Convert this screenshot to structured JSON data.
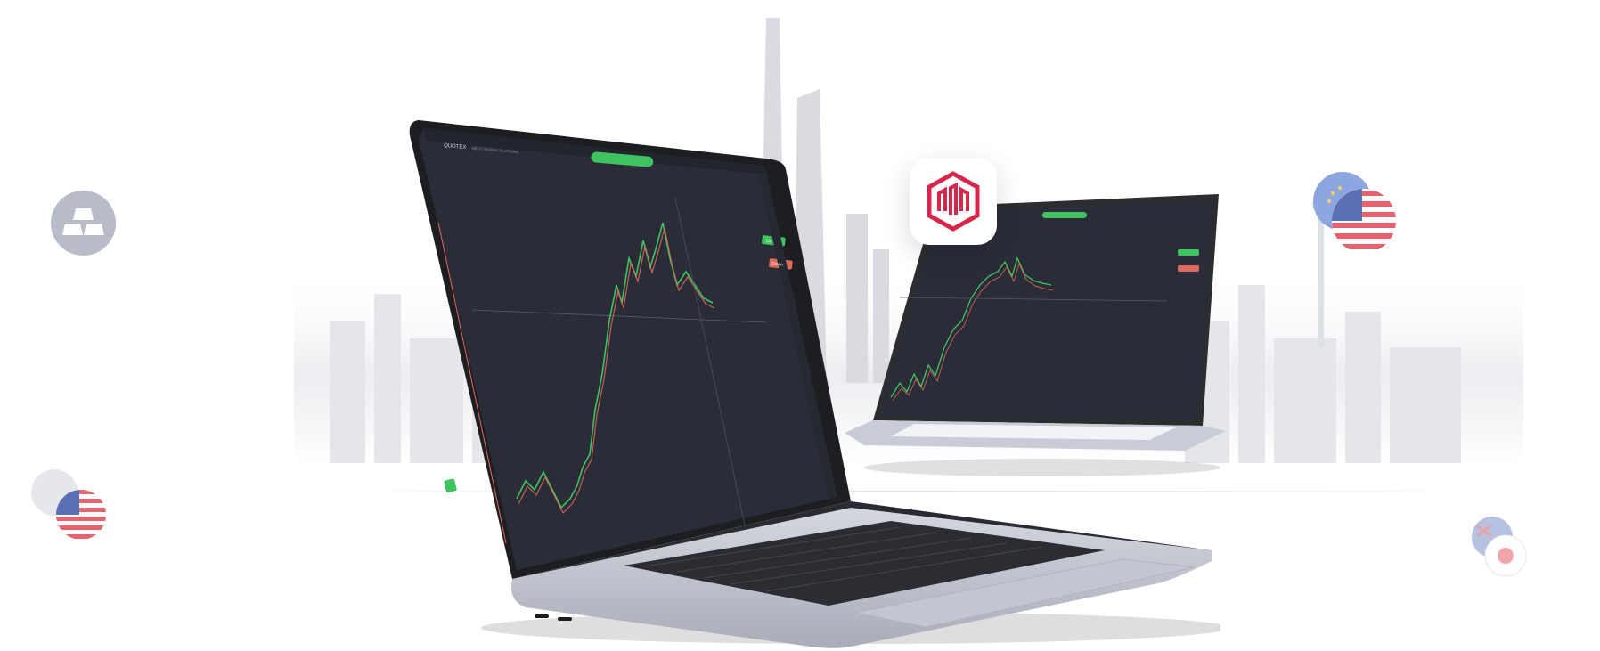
{
  "brand": {
    "name": "QUOTEX",
    "tagline": "BEST TRADING PLATFORM",
    "logo_color": "#d7264a"
  },
  "front_screen": {
    "top_pill": "",
    "buy_label": "Up",
    "sell_label": "Down",
    "accent_green": "#3fc35f",
    "accent_red": "#e06a5b"
  },
  "icons": {
    "gold_asset": "gold-bars-icon",
    "usd_flag": "us-flag-icon",
    "eur_flag": "eu-flag-icon",
    "aud_flag": "au-flag-icon",
    "jpy_flag": "jp-flag-icon"
  },
  "colors": {
    "screen_bg": "#2a2d38",
    "laptop_body": "#c9ccd6",
    "laptop_dark": "#2c2d31"
  }
}
